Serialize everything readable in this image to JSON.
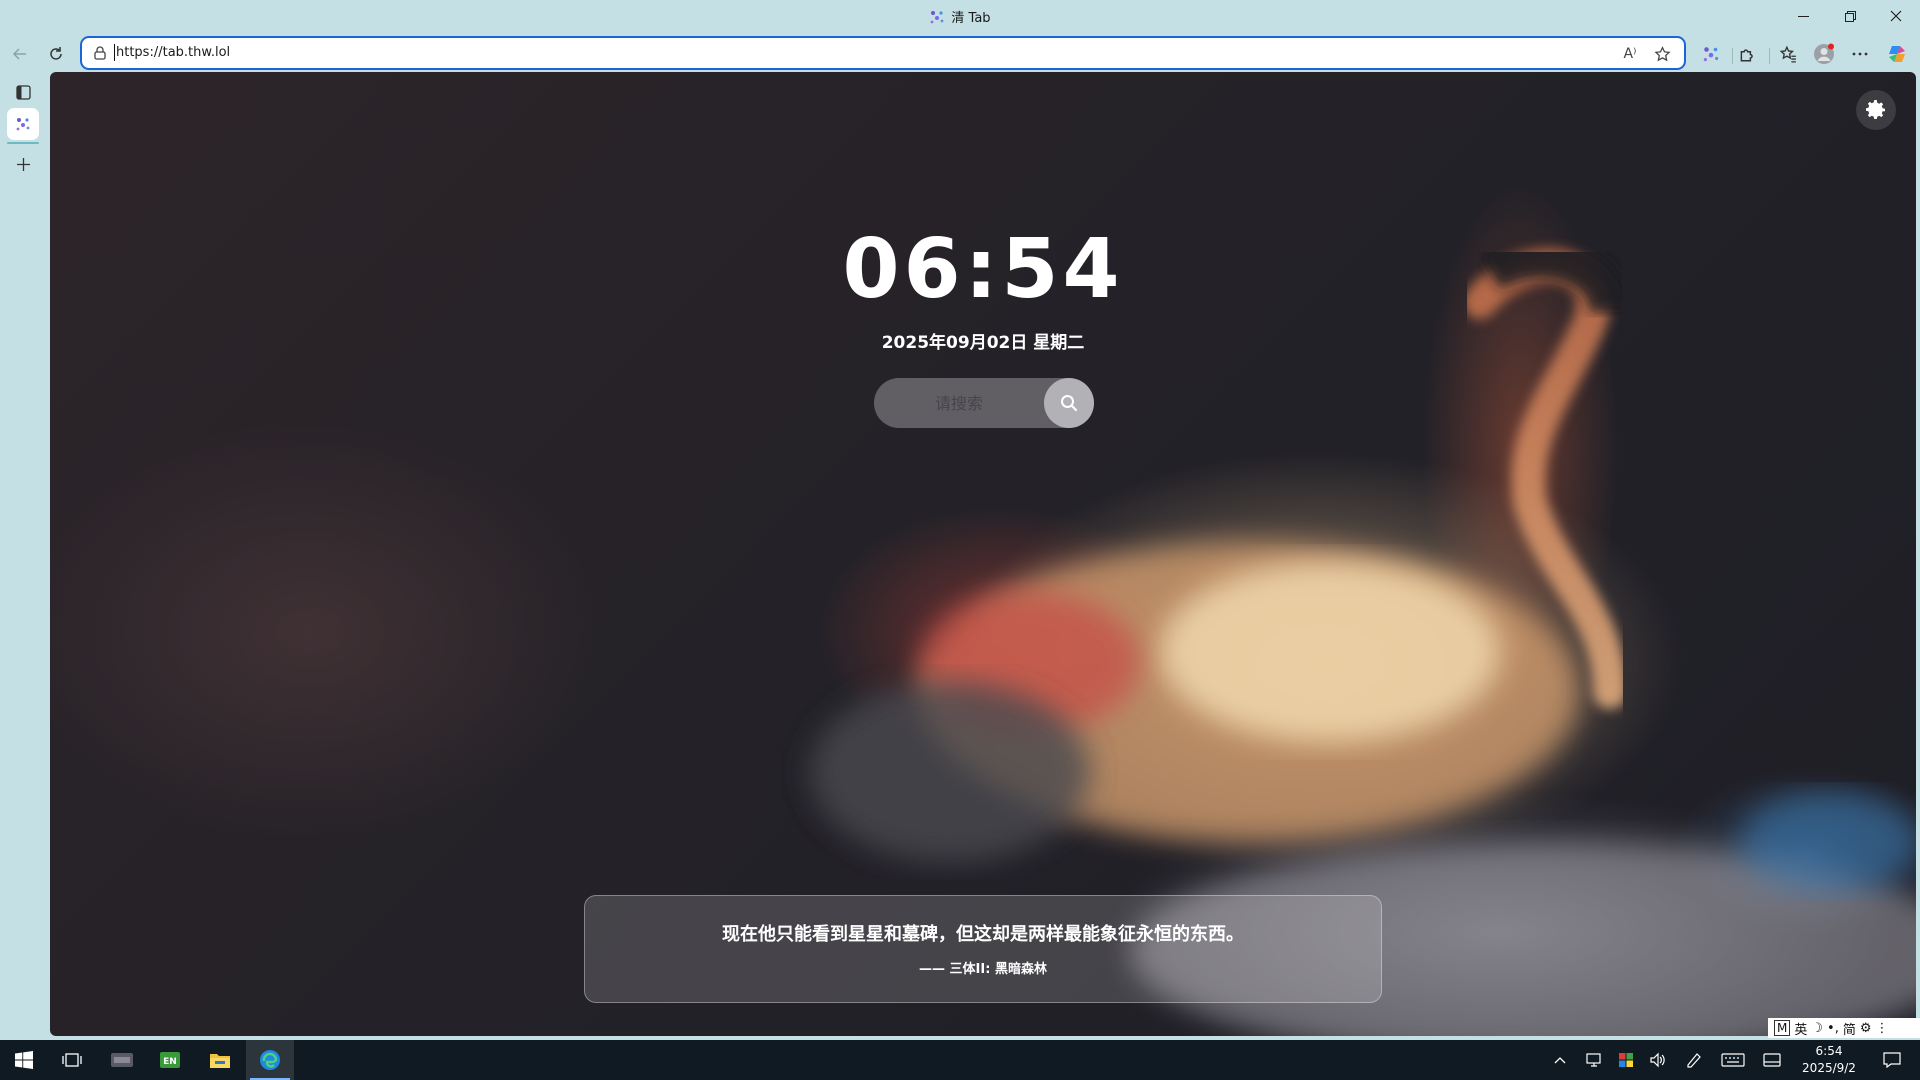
{
  "window": {
    "title": "清 Tab",
    "minimize_icon": "minimize-icon",
    "restore_icon": "restore-icon",
    "close_icon": "close-icon"
  },
  "navbar": {
    "url": "https://tab.thw.lol",
    "back_icon": "back-arrow-icon",
    "refresh_icon": "refresh-icon",
    "read_aloud_label": "A⁾",
    "favorite_icon": "star-icon",
    "tools": [
      "tab-extension-icon",
      "puzzle-extensions-icon",
      "favorites-icon",
      "profile-avatar-icon",
      "more-icon",
      "copilot-icon"
    ]
  },
  "sidetabs": {
    "tab_actions_icon": "tab-actions-icon",
    "active_tab_icon": "qing-tab-icon",
    "new_tab_icon": "plus-icon"
  },
  "page": {
    "time": "06:54",
    "date": "2025年09月02日 星期二",
    "search_placeholder": "请搜索",
    "search_icon": "search-icon",
    "settings_icon": "gear-icon",
    "quote": "现在他只能看到星星和墓碑，但这却是两样最能象征永恒的东西。",
    "quote_source": "—— 三体II: 黑暗森林"
  },
  "ime": {
    "items": [
      "M",
      "英",
      "☽",
      "•,",
      "简",
      "⚙",
      "⋮"
    ]
  },
  "taskbar": {
    "apps": [
      "windows-start-icon",
      "task-view-icon",
      "app-tile-icon",
      "en-app-icon",
      "file-explorer-icon",
      "edge-browser-icon"
    ],
    "tray_icons": [
      "chevron-up-icon",
      "network-icon",
      "security-icon",
      "volume-icon",
      "pen-icon",
      "keyboard-icon",
      "tablet-icon",
      "notification-icon"
    ],
    "time": "6:54",
    "date": "2025/9/2"
  },
  "colors": {
    "chrome_bg": "#c5e0e4",
    "address_border": "#1a66d4",
    "taskbar_bg": "#101a22"
  }
}
